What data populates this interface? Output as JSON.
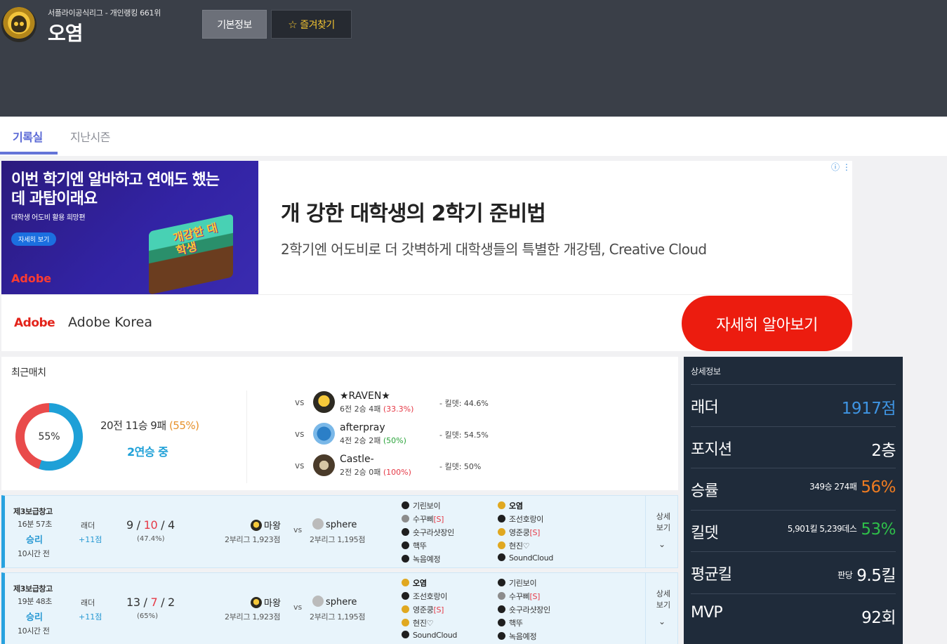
{
  "header": {
    "league": "서플라이공식리그 - 개인랭킹 661위",
    "player_name": "오염",
    "btn_info": "기본정보",
    "btn_fav": "즐겨찾기"
  },
  "tabs": {
    "active": "기록실",
    "inactive": "지난시즌"
  },
  "ad": {
    "image_headline": "이번 학기엔 알바하고 연애도 했는데 과탑이래요",
    "image_sub": "대학생 어도비 활용 희망편",
    "image_btn": "자세히 보기",
    "image_brand": "Adobe",
    "image_deco": "개강한 대학생",
    "title": "개 강한 대학생의 2학기 준비법",
    "desc": "2학기엔 어도비로 더 갓벽하게 대학생들의 특별한 개강템, Creative Cloud",
    "brand_logo": "Adobe",
    "brand_name": "Adobe Korea",
    "cta": "자세히 알아보기"
  },
  "recent": {
    "title": "최근매치",
    "win_rate": 55,
    "donut_label": "55%",
    "record": "20전 11승 9패",
    "record_pct": "(55%)",
    "streak": "2연승 중",
    "opponents": [
      {
        "vs": "vs",
        "name": "★RAVEN★",
        "record": "6전 2승 4패",
        "pct": "(33.3%)",
        "kd": "- 킬뎃: 44.6%",
        "pct_color": "red",
        "kd_color": ""
      },
      {
        "vs": "vs",
        "name": "afterpray",
        "record": "4전 2승 2패",
        "pct": "(50%)",
        "kd": "- 킬뎃: 54.5%",
        "pct_color": "green",
        "kd_color": "green"
      },
      {
        "vs": "vs",
        "name": "Castle-",
        "record": "2전 2승 0패",
        "pct": "(100%)",
        "kd": "- 킬뎃: 50%",
        "pct_color": "red",
        "kd_color": "green"
      }
    ]
  },
  "matches": [
    {
      "map": "제3보급창고",
      "time": "16분 57초",
      "result": "승리",
      "ago": "10시간 전",
      "ladder_label": "래더",
      "ladder_delta": "+11점",
      "kda_k": "9",
      "kda_d": "10",
      "kda_a": "4",
      "kda_pct": "(47.4%)",
      "p1": "마왕",
      "p1_sub": "2부리그 1,923점",
      "vs": "vs",
      "p2": "sphere",
      "p2_sub": "2부리그 1,195점",
      "team_a": [
        {
          "name": "기린보이",
          "tag": "",
          "bold": false,
          "dot": "black"
        },
        {
          "name": "수꾸삐",
          "tag": "[S]",
          "bold": false,
          "dot": "gray"
        },
        {
          "name": "숏구라샷장인",
          "tag": "",
          "bold": false,
          "dot": "black"
        },
        {
          "name": "핵뚜",
          "tag": "",
          "bold": false,
          "dot": "black"
        },
        {
          "name": "녹음예정",
          "tag": "",
          "bold": false,
          "dot": "black"
        }
      ],
      "team_b": [
        {
          "name": "오염",
          "tag": "",
          "bold": true,
          "dot": "gold"
        },
        {
          "name": "조선호랑이",
          "tag": "",
          "bold": false,
          "dot": "black"
        },
        {
          "name": "영준쿵",
          "tag": "[S]",
          "bold": false,
          "dot": "gold"
        },
        {
          "name": "현진♡",
          "tag": "",
          "bold": false,
          "dot": "gold"
        },
        {
          "name": "SoundCloud",
          "tag": "",
          "bold": false,
          "dot": "black"
        }
      ],
      "detail": "상세 보기"
    },
    {
      "map": "제3보급창고",
      "time": "19분 48초",
      "result": "승리",
      "ago": "10시간 전",
      "ladder_label": "래더",
      "ladder_delta": "+11점",
      "kda_k": "13",
      "kda_d": "7",
      "kda_a": "2",
      "kda_pct": "(65%)",
      "p1": "마왕",
      "p1_sub": "2부리그 1,923점",
      "vs": "vs",
      "p2": "sphere",
      "p2_sub": "2부리그 1,195점",
      "team_a": [
        {
          "name": "오염",
          "tag": "",
          "bold": true,
          "dot": "gold"
        },
        {
          "name": "조선호랑이",
          "tag": "",
          "bold": false,
          "dot": "black"
        },
        {
          "name": "영준쿵",
          "tag": "[S]",
          "bold": false,
          "dot": "gold"
        },
        {
          "name": "현진♡",
          "tag": "",
          "bold": false,
          "dot": "gold"
        },
        {
          "name": "SoundCloud",
          "tag": "",
          "bold": false,
          "dot": "black"
        }
      ],
      "team_b": [
        {
          "name": "기린보이",
          "tag": "",
          "bold": false,
          "dot": "black"
        },
        {
          "name": "수꾸삐",
          "tag": "[S]",
          "bold": false,
          "dot": "gray"
        },
        {
          "name": "숏구라샷장인",
          "tag": "",
          "bold": false,
          "dot": "black"
        },
        {
          "name": "핵뚜",
          "tag": "",
          "bold": false,
          "dot": "black"
        },
        {
          "name": "녹음예정",
          "tag": "",
          "bold": false,
          "dot": "black"
        }
      ],
      "detail": "상세 보기"
    }
  ],
  "panel": {
    "title": "상세정보",
    "rows": [
      {
        "label": "래더",
        "small": "",
        "value": "1917점",
        "color": "blue"
      },
      {
        "label": "포지션",
        "small": "",
        "value": "2층",
        "color": ""
      },
      {
        "label": "승률",
        "small": "349승 274패",
        "value": "56%",
        "color": "orange"
      },
      {
        "label": "킬뎃",
        "small": "5,901킬 5,239데스",
        "value": "53%",
        "color": "green"
      },
      {
        "label": "평균킬",
        "small": "판당",
        "value": "9.5킬",
        "color": ""
      },
      {
        "label": "MVP",
        "small": "",
        "value": "92회",
        "color": ""
      }
    ]
  },
  "colors": {
    "header_bg": "#3a3f48",
    "accent": "#6474d8",
    "win_blue": "#1ea0d7",
    "loss_red": "#e94b4b",
    "panel_bg": "#1f2b3a",
    "ad_cta": "#ec1c0f"
  }
}
